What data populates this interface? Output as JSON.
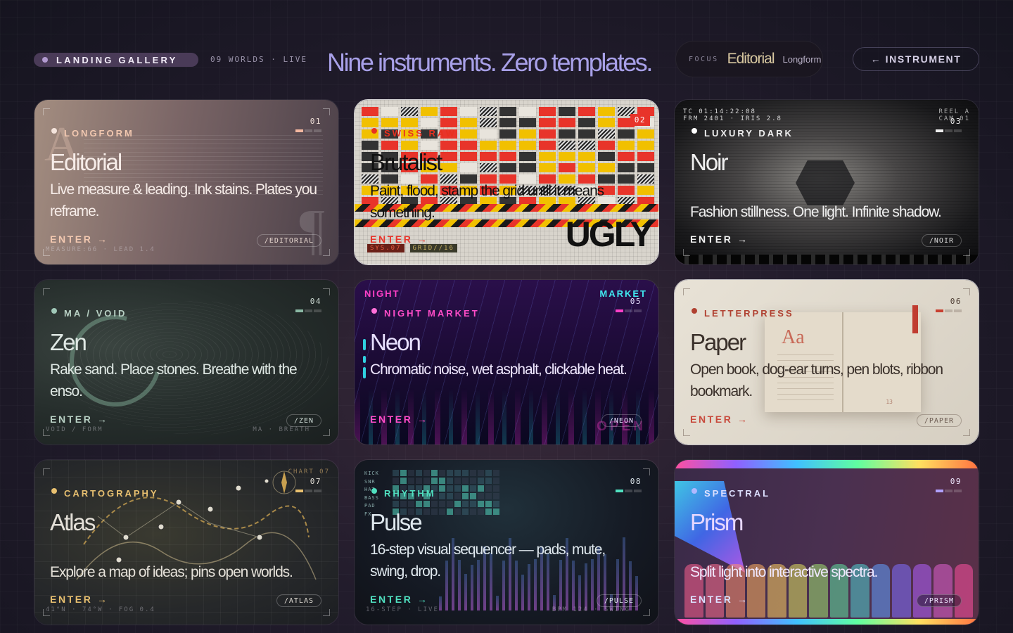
{
  "header": {
    "pill": "LANDING GALLERY",
    "meta": "09 WORLDS · LIVE",
    "headline": "Nine instruments. Zero templates.",
    "focus_label": "FOCUS",
    "focus_value": "Editorial",
    "focus_sub": "Longform",
    "instrument_button": "← INSTRUMENT"
  },
  "colors": {
    "accent": "#a8a0e8",
    "background": "#1c1a26"
  },
  "cards": [
    {
      "num": "01",
      "tag": "LONGFORM",
      "title": "Editorial",
      "desc": "Live measure & leading. Ink stains. Plates you reframe.",
      "enter": "ENTER →",
      "slug": "/EDITORIAL",
      "footer": "MEASURE:66 · LEAD 1.4"
    },
    {
      "num": "02",
      "tag": "SWISS RAW",
      "title": "Brutalist",
      "desc": "Paint, flood, stamp the grid until it means something.",
      "enter": "ENTER →",
      "slug": "",
      "badge": "UGLY",
      "sys1": "SYS.07",
      "sys2": "GRID//16"
    },
    {
      "num": "03",
      "tag": "LUXURY DARK",
      "title": "Noir",
      "desc": "Fashion stillness. One light. Infinite shadow.",
      "enter": "ENTER →",
      "slug": "/NOIR",
      "timecode1": "TC 01:14:22:08",
      "timecode2": "FRM 2401 · IRIS 2.8",
      "reel1": "REEL A",
      "reel2": "CAM 01"
    },
    {
      "num": "04",
      "tag": "MA / VOID",
      "title": "Zen",
      "desc": "Rake sand. Place stones. Breathe with the enso.",
      "enter": "ENTER →",
      "slug": "/ZEN",
      "footer": "VOID / FORM",
      "footer_r": "MA · BREATH"
    },
    {
      "num": "05",
      "tag": "NIGHT MARKET",
      "title": "Neon",
      "desc": "Chromatic noise, wet asphalt, clickable heat.",
      "enter": "ENTER →",
      "slug": "/NEON",
      "sign_left": "NIGHT",
      "sign_right": "MARKET",
      "sign_open": "OPEN"
    },
    {
      "num": "06",
      "tag": "LETTERPRESS",
      "title": "Paper",
      "desc": "Open book, dog-ear turns, pen blots, ribbon bookmark.",
      "enter": "ENTER →",
      "slug": "/PAPER",
      "book_glyph": "Aa",
      "page_num": "13"
    },
    {
      "num": "07",
      "tag": "CARTOGRAPHY",
      "title": "Atlas",
      "desc": "Explore a map of ideas; pins open worlds.",
      "enter": "ENTER →",
      "slug": "/ATLAS",
      "footer": "41°N · 74°W · FOG 0.4",
      "chart_label": "CHART 07"
    },
    {
      "num": "08",
      "tag": "RHYTHM",
      "title": "Pulse",
      "desc": "16-step visual sequencer — pads, mute, swing, drop.",
      "enter": "ENTER →",
      "slug": "/PULSE",
      "footer": "16-STEP · LIVE",
      "footer_r": "BPM 124 · SWING",
      "tracks": [
        "KICK",
        "SNR",
        "HAT",
        "BASS",
        "PAD",
        "FX"
      ]
    },
    {
      "num": "09",
      "tag": "SPECTRAL",
      "title": "Prism",
      "desc": "Split light into interactive spectra.",
      "enter": "ENTER →",
      "slug": "/PRISM"
    }
  ]
}
